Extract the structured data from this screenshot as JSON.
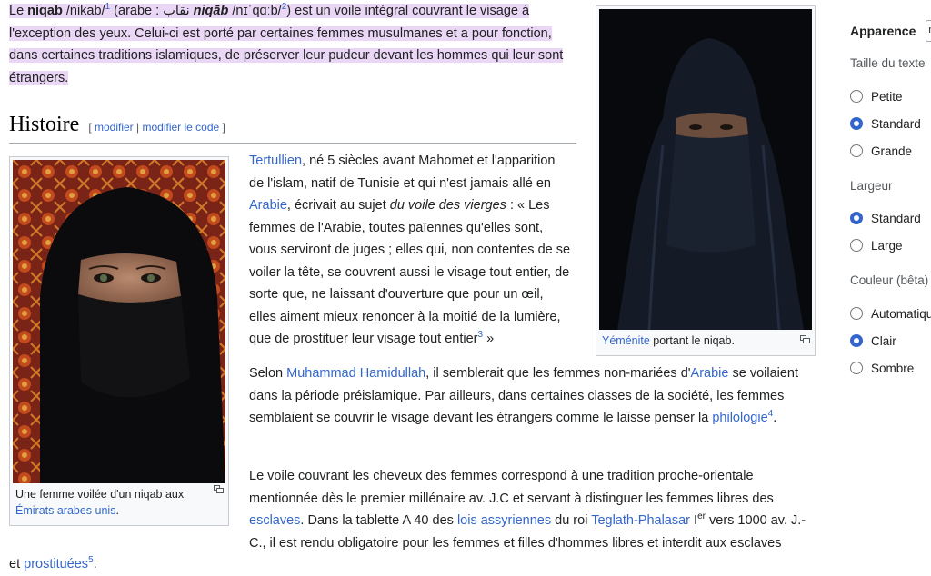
{
  "intro": {
    "le": "Le ",
    "term": "niqab",
    "ipa": " /nikab/",
    "ref1": "1",
    "arabic_open": " (arabe : ",
    "arabic_script": "نقاب",
    "arabic_space": " ",
    "translit": "niqāb",
    "ipa2": " /nɪˈqɑːb/",
    "ref2": "2",
    "rest": ") est un voile intégral couvrant le visage à l'exception des yeux. Celui-ci est porté par certaines femmes musulmanes et a pour fonction, dans certaines traditions islamiques, de préserver leur pudeur devant les hommes qui leur sont étrangers."
  },
  "section": {
    "title": "Histoire",
    "edit_open": "[ ",
    "edit_modifier": "modifier",
    "edit_sep": " | ",
    "edit_code": "modifier le code",
    "edit_close": " ]"
  },
  "figure_left": {
    "caption_text": "Une femme voilée d'un niqab aux ",
    "caption_link": "Émirats arabes unis",
    "caption_end": "."
  },
  "figure_right": {
    "caption_link": "Yéménite",
    "caption_text": " portant le niqab."
  },
  "p1": {
    "link_tertullien": "Tertullien",
    "t1": ", né 5 siècles avant Mahomet et l'apparition de l'islam, natif de Tunisie et qui n'est jamais allé en ",
    "link_arabie": "Arabie",
    "t2": ", écrivait au sujet ",
    "title_italic": "du voile des vierges",
    "t3": " : « Les femmes de l'Arabie, toutes païennes qu'elles sont, vous serviront de juges ; elles qui, non contentes de se voiler la tête, se couvrent aussi le visage tout entier, de sorte que, ne laissant d'ouverture que pour un œil, elles aiment mieux renoncer à la moitié de la lumière, que de prostituer leur visage tout entier",
    "ref3": "3",
    "t4": " »"
  },
  "p2": {
    "t1": "Selon ",
    "link_hamidullah": "Muhammad Hamidullah",
    "t2": ", il semblerait que les femmes non-mariées d'",
    "link_arabie": "Arabie",
    "t3": " se voilaient dans la période préislamique. Par ailleurs, dans certaines classes de la société, les femmes semblaient se couvrir le visage devant les étrangers comme le laisse penser la ",
    "link_philologie": "philologie",
    "ref4": "4",
    "t4": "."
  },
  "p3": {
    "t1": "Le voile couvrant les cheveux des femmes correspond à une tradition proche-orientale mentionnée dès le premier millénaire av. J.C et servant à distinguer les femmes libres des ",
    "link_esclaves": "esclaves",
    "t2": ". Dans la tablette A 40 des ",
    "link_lois": "lois assyriennes",
    "t3": " du roi ",
    "link_teglath": "Teglath-Phalasar",
    "t4": " I",
    "sup_er": "er",
    "t5": " vers 1000 av. J.-C., il est rendu obligatoire pour les femmes et filles d'hommes libres et interdit aux esclaves"
  },
  "tail": {
    "t1": "et ",
    "link_prostituees": "prostituées",
    "ref5": "5",
    "t2": "."
  },
  "appearance": {
    "heading": "Apparence",
    "hide_label": "m",
    "text_size": {
      "label": "Taille du texte",
      "options": [
        "Petite",
        "Standard",
        "Grande"
      ],
      "selected": "Standard"
    },
    "width": {
      "label": "Largeur",
      "options": [
        "Standard",
        "Large"
      ],
      "selected": "Standard"
    },
    "color": {
      "label": "Couleur (bêta)",
      "options": [
        "Automatique",
        "Clair",
        "Sombre"
      ],
      "selected": "Clair"
    }
  },
  "colors": {
    "link": "#3366cc",
    "highlight": "#ead6f5",
    "radio_selected": "#3366cc"
  }
}
